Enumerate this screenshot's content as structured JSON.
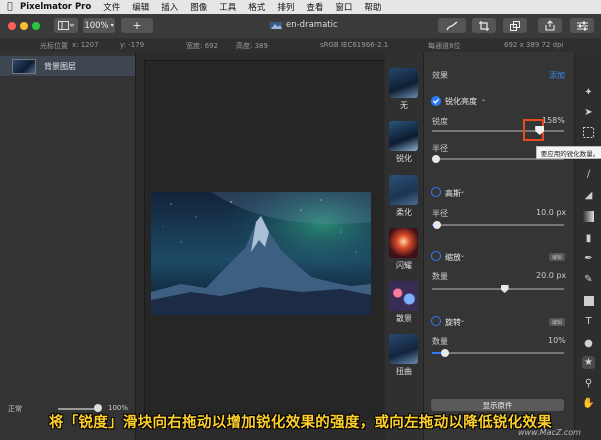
{
  "menubar": {
    "app_name": "Pixelmator Pro",
    "items": [
      "文件",
      "编辑",
      "插入",
      "图像",
      "工具",
      "格式",
      "排列",
      "查看",
      "窗口",
      "帮助"
    ]
  },
  "toolbar": {
    "zoom": "100%",
    "add_label": "+",
    "document_title": "en-dramatic"
  },
  "infobar": {
    "cursor_label": "光标位置",
    "cursor_x": "x: 1207",
    "cursor_y": "y: -179",
    "width": "宽度: 692",
    "height": "高度: 389",
    "color_profile": "sRGB IEC61966-2.1",
    "bit_depth": "每通道8位",
    "dimensions": "692 x 389 72 dpi"
  },
  "layers": {
    "layer_name": "背景图层",
    "blend_mode": "正常",
    "opacity": "100%"
  },
  "effects_browser": {
    "items": [
      "无",
      "锐化",
      "柔化",
      "闪耀",
      "散景",
      "扭曲"
    ]
  },
  "effects_panel": {
    "header": "效果",
    "add_label": "添加",
    "sharpen": {
      "title": "锐化亮度",
      "sharpness_label": "锐度",
      "sharpness_value": "158%",
      "sharpness_level": 0.82,
      "radius_label": "半径",
      "radius_level": 0.03
    },
    "highpass": {
      "title": "高斯",
      "radius_label": "半径",
      "radius_value": "10.0 px",
      "radius_level": 0.04
    },
    "zoom": {
      "title": "缩放",
      "edit_label": "编辑",
      "amount_label": "数量",
      "amount_value": "20.0 px",
      "amount_level": 0.55
    },
    "twirl": {
      "title": "旋转",
      "edit_label": "编辑",
      "amount_label": "数量",
      "amount_value": "10%",
      "amount_level": 0.1
    },
    "show_original": "显示原件"
  },
  "tooltip": "要应用的锐化数量。",
  "caption": "将「锐度」滑块向右拖动以增加锐化效果的强度，或向左拖动以降低锐化效果",
  "watermark": "www.MacZ.com",
  "colors": {
    "accent": "#2d7cf6",
    "highlight": "#e84c1e",
    "caption": "#ffd02a"
  }
}
